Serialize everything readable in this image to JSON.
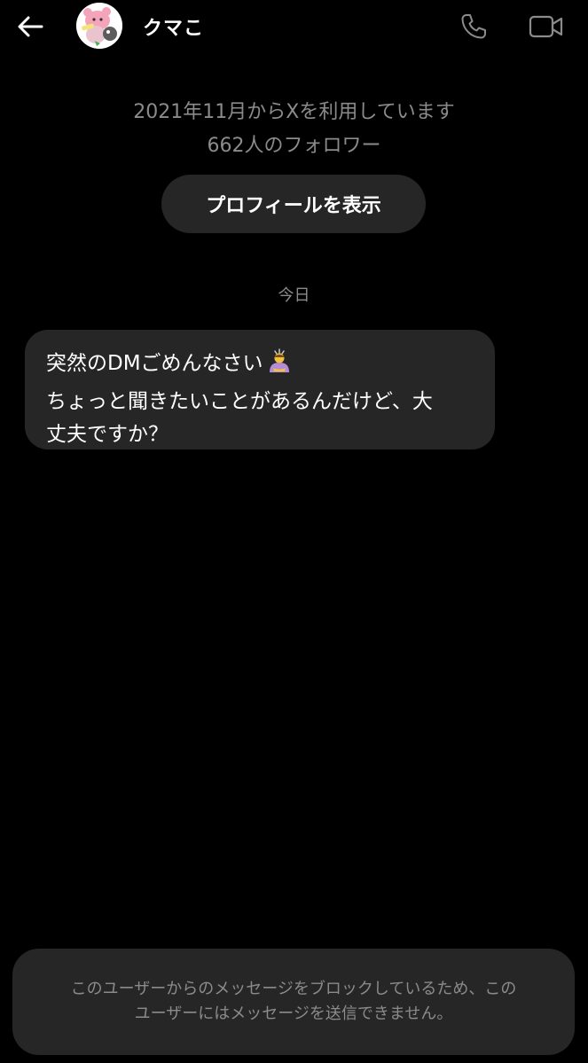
{
  "header": {
    "back_icon": "arrow-left-icon",
    "username": "クマこ",
    "avatar": "profile-avatar",
    "call_icon": "phone-icon",
    "video_icon": "video-camera-icon"
  },
  "profile_info": {
    "joined": "2021年11月からXを利用しています",
    "followers": "662人のフォロワー",
    "view_profile_label": "プロフィールを表示"
  },
  "conversation": {
    "date_separator": "今日",
    "messages": [
      {
        "from": "received",
        "lines": [
          "突然のDMごめんなさい",
          "ちょっと聞きたいことがあるんだけど、大",
          "丈夫ですか？"
        ],
        "emoji": "person-bowing-emoji"
      }
    ]
  },
  "blocked_notice": {
    "line1": "このユーザーからのメッセージをブロックしているため、この",
    "line2": "ユーザーにはメッセージを送信できません。"
  },
  "colors": {
    "background": "#000000",
    "surface": "#262626",
    "text_primary": "#ffffff",
    "text_secondary": "#8b8b8b"
  }
}
